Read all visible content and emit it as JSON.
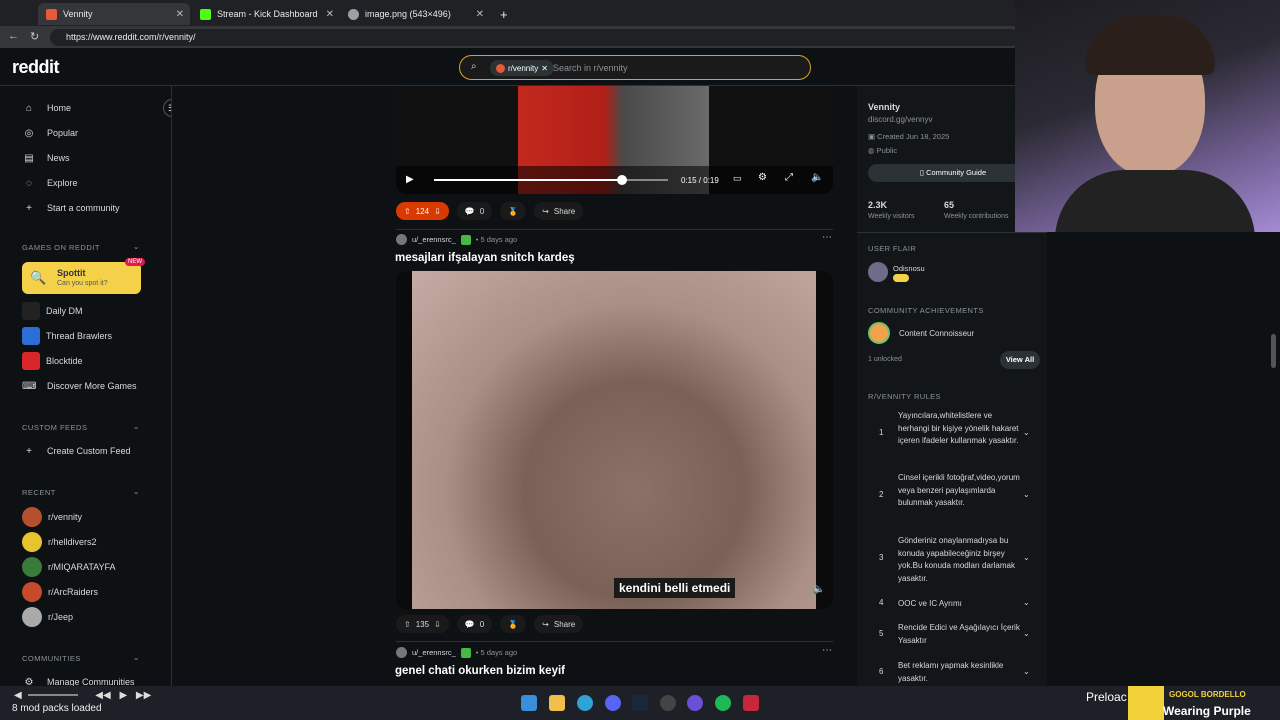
{
  "browser": {
    "tabs": [
      {
        "title": "Vennity",
        "color": "#e55a3a"
      },
      {
        "title": "Stream - Kick Dashboard",
        "color": "#53fc18"
      },
      {
        "title": "image.png (543×496)",
        "color": "#9aa0a6"
      }
    ],
    "url": "https://www.reddit.com/r/vennity/"
  },
  "header": {
    "logo": "reddit",
    "search_chip": "r/vennity",
    "search_placeholder": "Search in r/vennity"
  },
  "sidebar": {
    "nav": [
      {
        "label": "Home",
        "icon": "home-icon"
      },
      {
        "label": "Popular",
        "icon": "popular-icon"
      },
      {
        "label": "News",
        "icon": "news-icon"
      },
      {
        "label": "Explore",
        "icon": "explore-icon"
      },
      {
        "label": "Start a community",
        "icon": "plus-icon"
      }
    ],
    "games_title": "GAMES ON REDDIT",
    "spottit": {
      "title": "Spottit",
      "subtitle": "Can you spot it?",
      "badge": "NEW"
    },
    "games": [
      "Daily DM",
      "Thread Brawlers",
      "Blocktide",
      "Discover More Games"
    ],
    "custom_feeds_title": "CUSTOM FEEDS",
    "create_feed": "Create Custom Feed",
    "recent_title": "RECENT",
    "recent": [
      "r/vennity",
      "r/helldivers2",
      "r/MIQARATAYFA",
      "r/ArcRaiders",
      "r/Jeep"
    ],
    "communities_title": "COMMUNITIES",
    "manage": "Manage Communities"
  },
  "posts": {
    "first": {
      "time": "0:15 / 0:19",
      "upvotes": "124",
      "comments": "0",
      "share": "Share"
    },
    "second": {
      "author": "u/_erennsrc_",
      "age": "• 5 days ago",
      "title": "mesajları ifşalayan snitch kardeş",
      "caption": "kendini belli etmedi",
      "upvotes": "135",
      "comments": "0",
      "share": "Share"
    },
    "third": {
      "author": "u/_erennsrc_",
      "age": "• 5 days ago",
      "title": "genel chati okurken bizim keyif"
    }
  },
  "community": {
    "name": "Vennity",
    "link": "discord.gg/vennyv",
    "created": "Created Jun 18, 2025",
    "visibility": "Public",
    "guide_button": "Community Guide",
    "visitors": "2.3K",
    "visitors_label": "Weekly visitors",
    "contributions": "65",
    "contributions_label": "Weekly contributions",
    "flair_title": "USER FLAIR",
    "flair_user": "Odisnosu",
    "achievements_title": "COMMUNITY ACHIEVEMENTS",
    "achievement": "Content Connoisseur",
    "unlocked": "1 unlocked",
    "view_all": "View All",
    "rules_title": "R/VENNITY RULES",
    "rules": [
      {
        "n": "1",
        "text": "Yayıncılara,whitelistlere ve herhangi bir kişiye yönelik hakaret içeren ifadeler kullanmak yasaktır."
      },
      {
        "n": "2",
        "text": "Cinsel içerikli fotoğraf,video,yorum veya benzeri paylaşımlarda bulunmak yasaktır."
      },
      {
        "n": "3",
        "text": "Gönderiniz onaylanmadıysa bu konuda yapabileceğiniz birşey yok.Bu konuda modları darlamak yasaktır."
      },
      {
        "n": "4",
        "text": "OOC ve IC Ayrımı"
      },
      {
        "n": "5",
        "text": "Rencide Edici ve Aşağılayıcı İçerik Yasaktır"
      },
      {
        "n": "6",
        "text": "Bet reklamı yapmak kesinlikle yasaktır."
      }
    ]
  },
  "stream_overlay": {
    "status": "8 mod packs loaded",
    "preload": "Preloac",
    "now_playing_artist": "GOGOL BORDELLO",
    "now_playing_title": "Wearing Purple"
  }
}
